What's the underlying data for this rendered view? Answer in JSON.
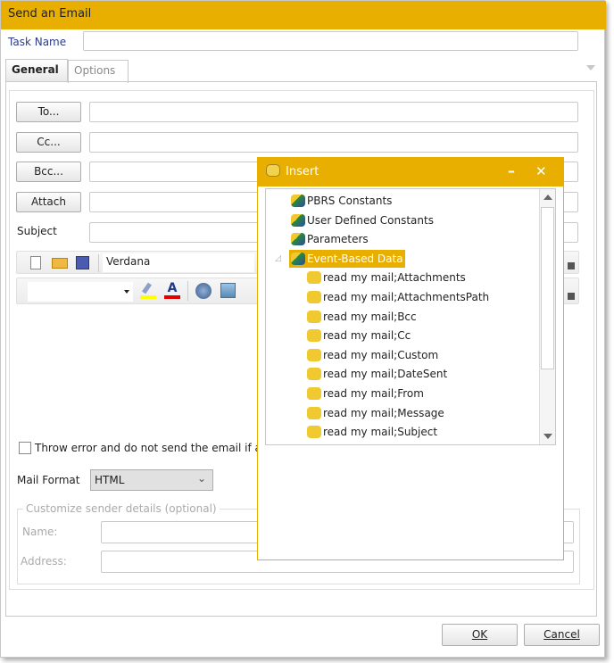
{
  "window": {
    "title": "Send an Email"
  },
  "task_name": {
    "label": "Task Name",
    "value": ""
  },
  "tabs": [
    {
      "label": "General",
      "active": true
    },
    {
      "label": "Options",
      "active": false
    }
  ],
  "recipients": [
    {
      "label": "To...",
      "value": ""
    },
    {
      "label": "Cc...",
      "value": ""
    },
    {
      "label": "Bcc...",
      "value": ""
    },
    {
      "label": "Attach",
      "value": ""
    }
  ],
  "subject": {
    "label": "Subject",
    "value": ""
  },
  "toolbar": {
    "font": "Verdana",
    "size": "",
    "icons": [
      "new-document-icon",
      "open-folder-icon",
      "save-icon",
      "highlight-icon",
      "font-color-icon",
      "hyperlink-icon",
      "image-icon"
    ],
    "highlight_color": "#ffff00",
    "font_color": "#e00000"
  },
  "throw_error": {
    "label": "Throw error and do not send the email if atta",
    "checked": false
  },
  "mail_format": {
    "label": "Mail Format",
    "value": "HTML"
  },
  "sender": {
    "legend": "Customize sender details (optional)",
    "name_label": "Name:",
    "address_label": "Address:",
    "name": "",
    "address": ""
  },
  "buttons": {
    "ok": "OK",
    "cancel": "Cancel"
  },
  "insert_dialog": {
    "title": "Insert",
    "minimize": "–",
    "close": "✕",
    "items": [
      {
        "label": "PBRS Constants",
        "level": 1
      },
      {
        "label": "User Defined Constants",
        "level": 1
      },
      {
        "label": "Parameters",
        "level": 1
      },
      {
        "label": "Event-Based Data",
        "level": 1,
        "selected": true,
        "expanded": true
      },
      {
        "label": "read my mail;Attachments",
        "level": 2
      },
      {
        "label": "read my mail;AttachmentsPath",
        "level": 2
      },
      {
        "label": "read my mail;Bcc",
        "level": 2
      },
      {
        "label": "read my mail;Cc",
        "level": 2
      },
      {
        "label": "read my mail;Custom",
        "level": 2
      },
      {
        "label": "read my mail;DateSent",
        "level": 2
      },
      {
        "label": "read my mail;From",
        "level": 2
      },
      {
        "label": "read my mail;Message",
        "level": 2
      },
      {
        "label": "read my mail;Subject",
        "level": 2
      }
    ]
  },
  "colors": {
    "accent": "#e8ae00"
  }
}
